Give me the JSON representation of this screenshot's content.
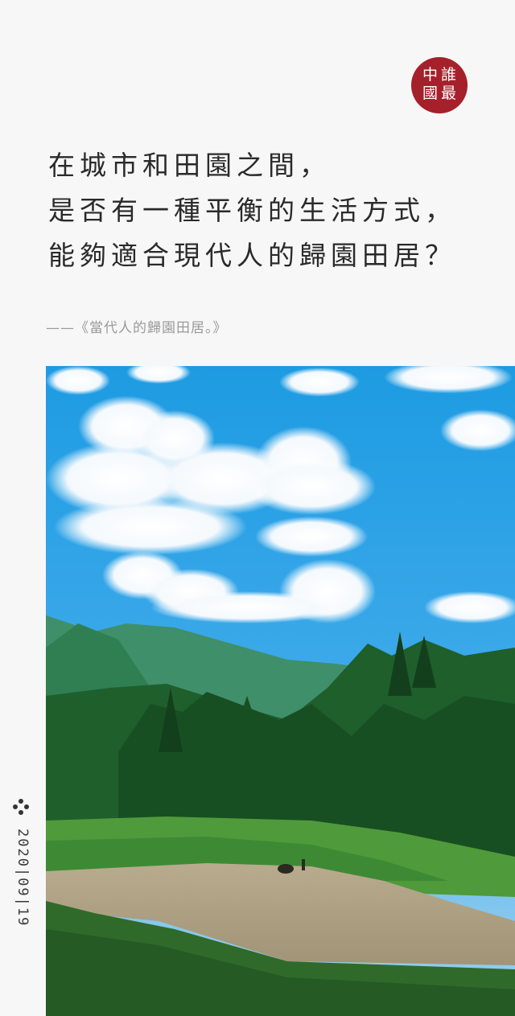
{
  "logo": {
    "chars": [
      "中",
      "誰",
      "國",
      "最"
    ],
    "color": "#a5202a"
  },
  "headline": {
    "lines": [
      "在城市和田園之間，",
      "是否有一種平衡的生活方式，",
      "能夠適合現代人的歸園田居？"
    ]
  },
  "attribution": "——《當代人的歸園田居。》",
  "photo": {
    "subject": "paddy-field-landscape"
  },
  "sidebar": {
    "icon": "four-dots-icon",
    "date": "2020|09|19"
  }
}
